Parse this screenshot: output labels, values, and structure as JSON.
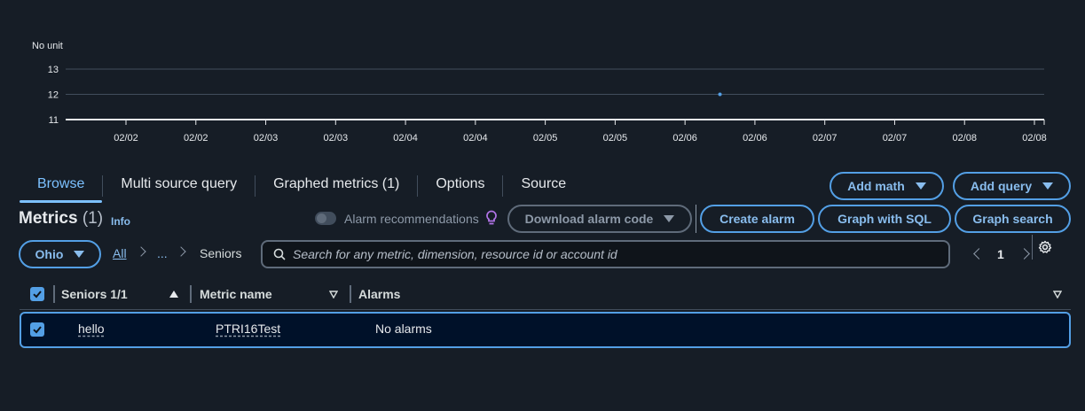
{
  "chart_data": {
    "type": "scatter",
    "unit_label": "No unit",
    "y_ticks": [
      "11",
      "12",
      "13"
    ],
    "ylim": [
      11,
      13
    ],
    "x_ticks": [
      "02/02",
      "02/02",
      "02/03",
      "02/03",
      "02/04",
      "02/04",
      "02/05",
      "02/05",
      "02/06",
      "02/06",
      "02/07",
      "02/07",
      "02/08",
      "02/08"
    ],
    "points": [
      {
        "x": "02/06",
        "y": 12
      }
    ],
    "grid": true,
    "colors": {
      "gridline": "#414d5c",
      "axis": "#e6e9ec",
      "point": "#539fe5"
    }
  },
  "tabs": [
    {
      "label": "Browse",
      "active": true
    },
    {
      "label": "Multi source query",
      "active": false
    },
    {
      "label": "Graphed metrics (1)",
      "active": false
    },
    {
      "label": "Options",
      "active": false
    },
    {
      "label": "Source",
      "active": false
    }
  ],
  "buttons": {
    "add_math": "Add math",
    "add_query": "Add query",
    "download_alarm_code": "Download alarm code",
    "create_alarm": "Create alarm",
    "graph_with_sql": "Graph with SQL",
    "graph_search": "Graph search",
    "region": "Ohio"
  },
  "metrics": {
    "title": "Metrics",
    "count": "(1)",
    "info": "Info",
    "alarm_recommendations": "Alarm recommendations"
  },
  "breadcrumb": {
    "all": "All",
    "ellipsis": "...",
    "current": "Seniors"
  },
  "search": {
    "placeholder": "Search for any metric, dimension, resource id or account id",
    "value": ""
  },
  "pagination": {
    "page": "1"
  },
  "table": {
    "headers": [
      "Seniors 1/1",
      "Metric name",
      "Alarms"
    ],
    "rows": [
      {
        "col1": "hello",
        "col2": "PTRI16Test",
        "col3": "No alarms",
        "selected": true
      }
    ]
  },
  "colors": {
    "background": "#161d26",
    "accent": "#539fe5",
    "link": "#89bdee",
    "selected_row_bg": "#001129"
  }
}
